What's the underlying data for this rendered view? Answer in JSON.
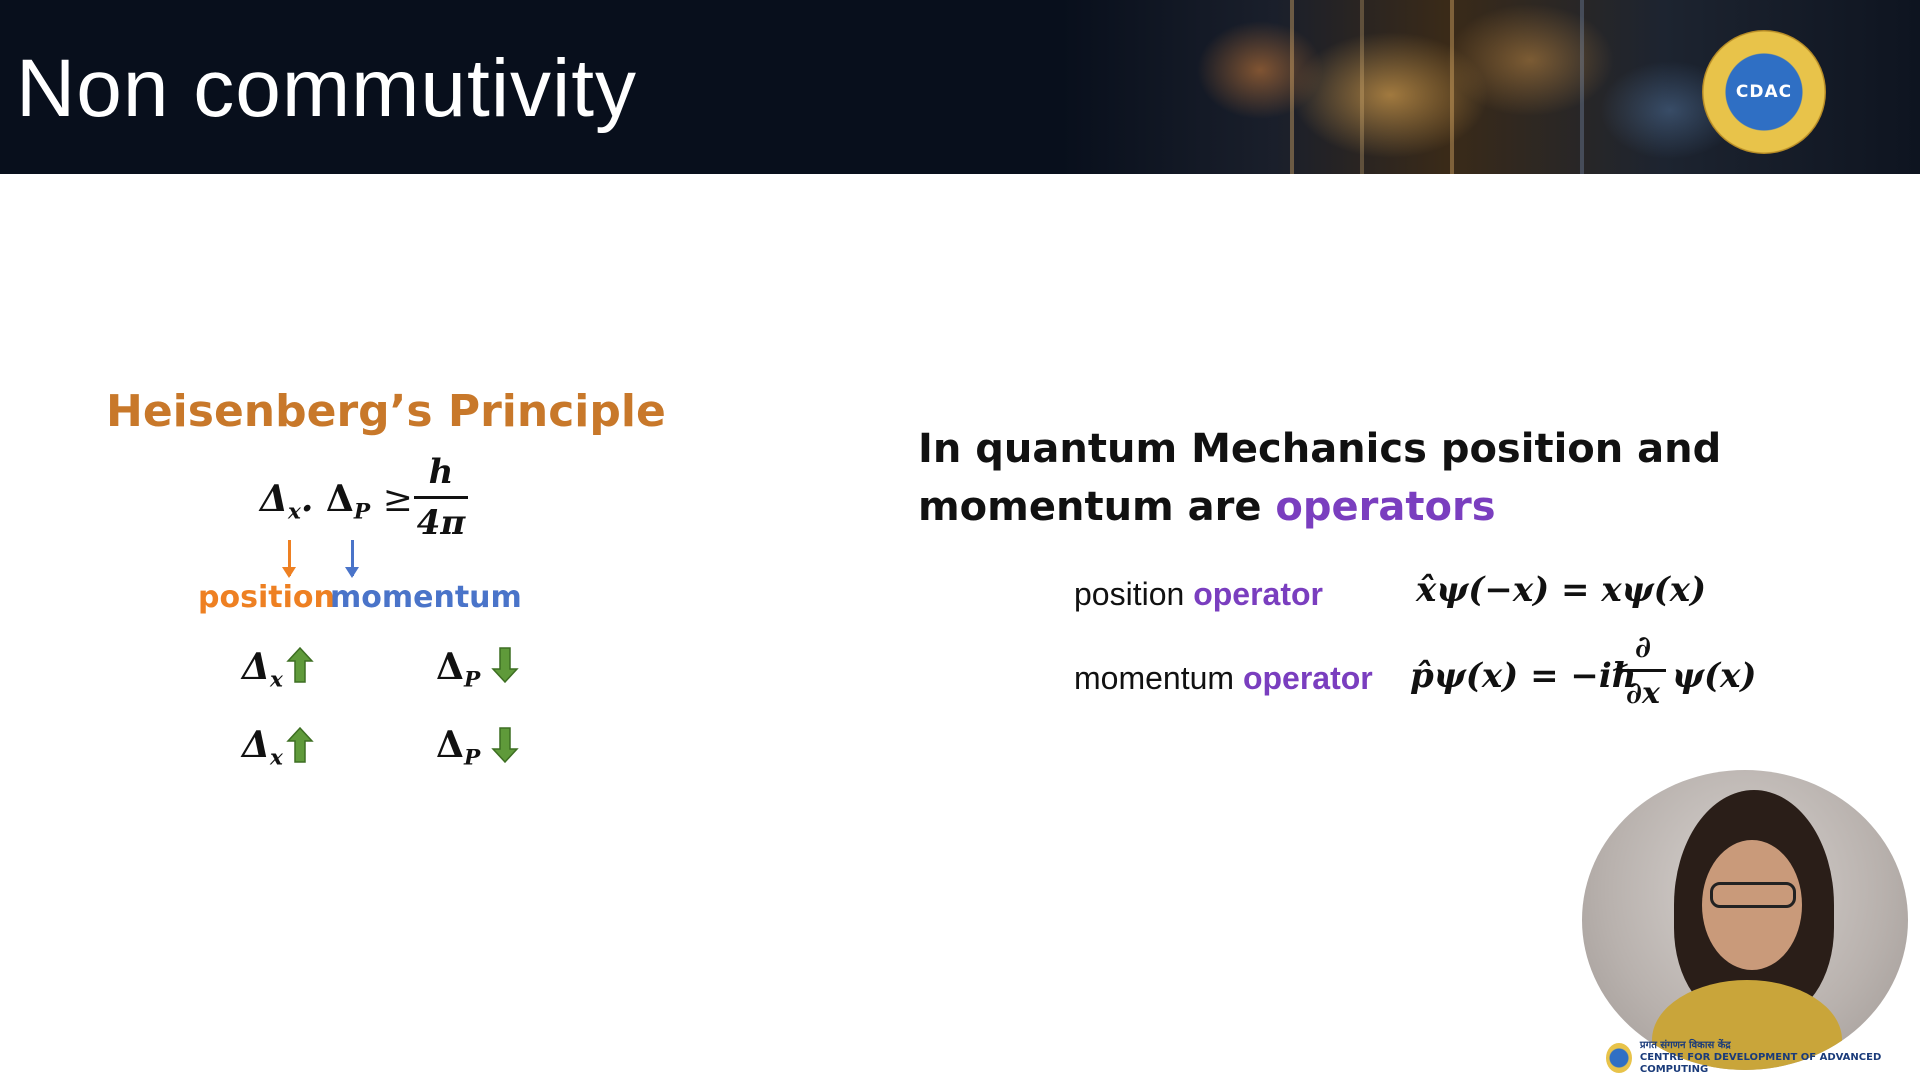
{
  "header": {
    "title": "Non commutivity",
    "logo_text": "CDAC"
  },
  "left": {
    "heading": "Heisenberg’s Principle",
    "inequality": {
      "lhs_dx": "Δ",
      "lhs_dx_sub": "x",
      "dot": ".",
      "lhs_dp": "Δ",
      "lhs_dp_sub": "P",
      "ge": "≥",
      "numerator": "h",
      "denominator": "4π"
    },
    "position_label": "position",
    "momentum_label": "momentum",
    "rows": [
      {
        "dx": "Δ",
        "dx_sub": "x",
        "dp": "Δ",
        "dp_sub": "P"
      },
      {
        "dx": "Δ",
        "dx_sub": "x",
        "dp": "Δ",
        "dp_sub": "P"
      }
    ],
    "colors": {
      "heading": "#c8782a",
      "position": "#ee8022",
      "momentum": "#4a74c9",
      "fat_arrow": "#5f9a3a"
    }
  },
  "right": {
    "statement_line1": "In quantum Mechanics position and",
    "statement_line2_pre": "momentum are ",
    "statement_line2_hl": "operators",
    "position_operator": {
      "label_pre": "position ",
      "label_hl": "operator",
      "equation": "x̂ψ(−x) = xψ(x)"
    },
    "momentum_operator": {
      "label_pre": "momentum ",
      "label_hl": "operator",
      "lhs": "p̂ψ(x) = −iℏ",
      "frac_num": "∂",
      "frac_den": "∂x",
      "rhs": "ψ(x)"
    },
    "colors": {
      "highlight": "#7a3ebf"
    }
  },
  "footer": {
    "logo_line1": "प्रगत संगणन विकास केंद्र",
    "logo_line2": "CENTRE FOR DEVELOPMENT OF ADVANCED COMPUTING"
  }
}
